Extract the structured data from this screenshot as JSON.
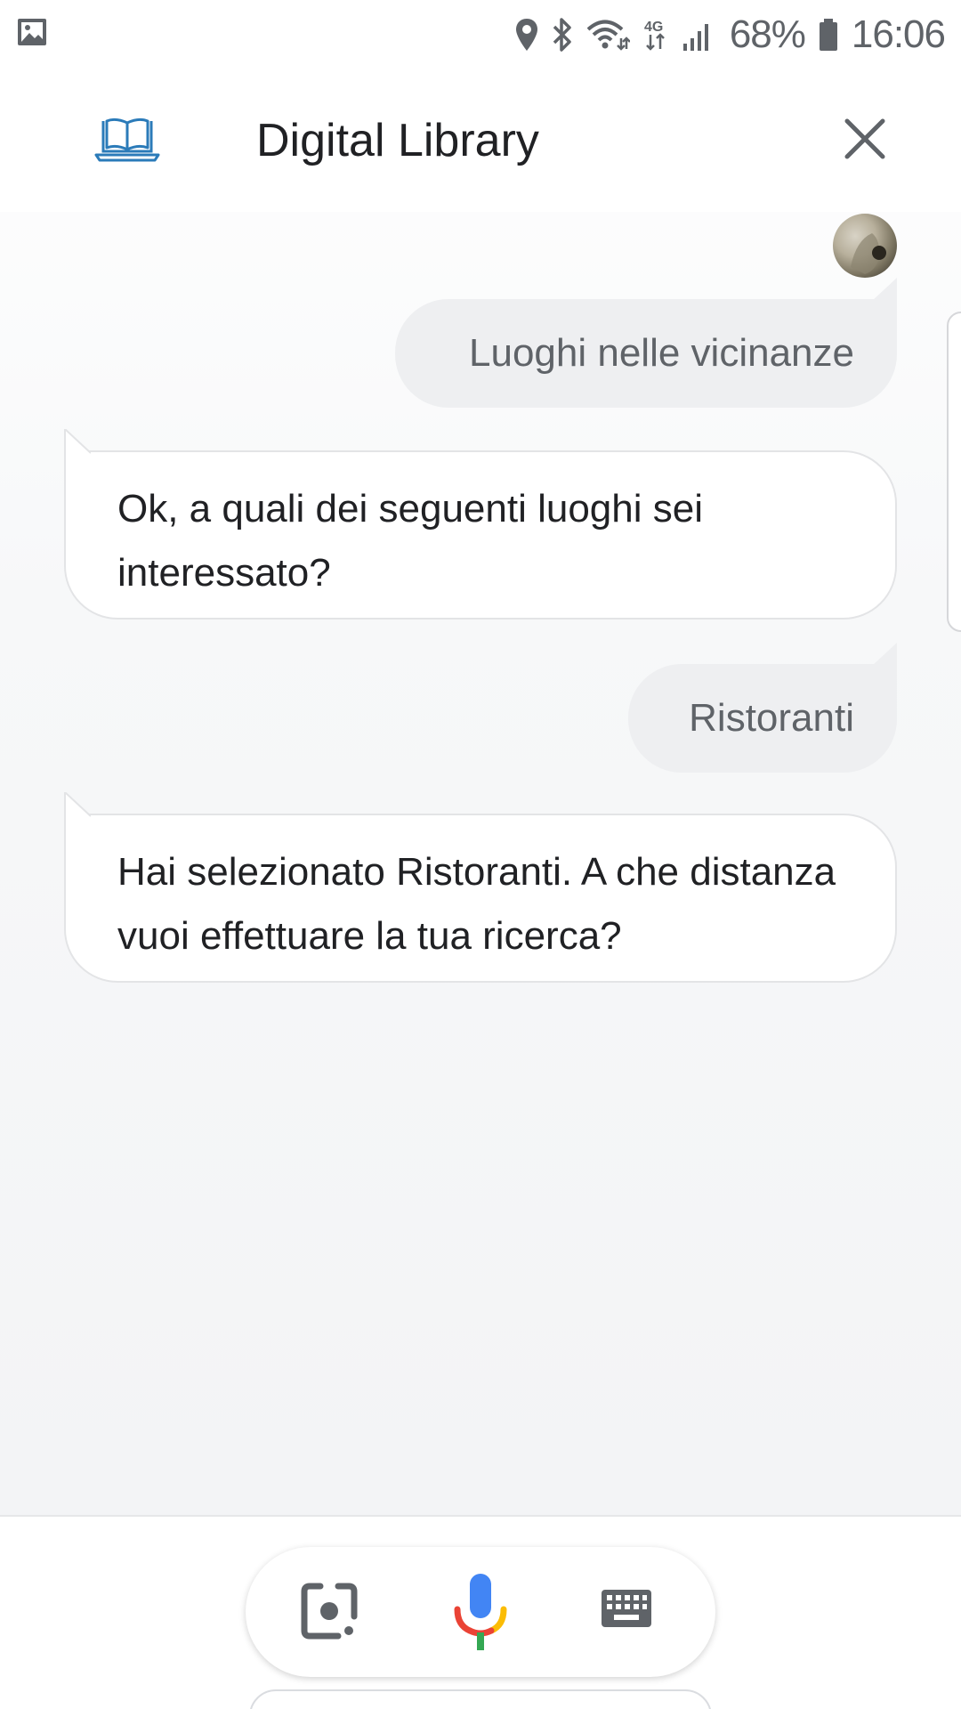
{
  "status_bar": {
    "battery_percent": "68%",
    "time": "16:06",
    "network_type": "4G",
    "icons": [
      "gallery-icon",
      "location-icon",
      "bluetooth-icon",
      "wifi-icon",
      "network-4g-icon",
      "signal-icon",
      "battery-icon"
    ]
  },
  "header": {
    "title": "Digital Library",
    "app_icon": "book-laptop-icon",
    "close_icon": "close-icon"
  },
  "conversation": [
    {
      "role": "user",
      "text": "Luoghi nelle vicinanze"
    },
    {
      "role": "assistant",
      "text": "Ok, a quali dei seguenti luoghi sei interessato?"
    },
    {
      "role": "user",
      "text": "Ristoranti"
    },
    {
      "role": "assistant",
      "text": "Hai selezionato Ristoranti. A che distanza vuoi effettuare la tua ricerca?"
    }
  ],
  "input_bar": {
    "buttons": [
      "lens-icon",
      "microphone-icon",
      "keyboard-icon"
    ]
  },
  "colors": {
    "accent_blue": "#1a73e8",
    "book_icon": "#2b7bb9",
    "mic_blue": "#4285f4",
    "mic_red": "#ea4335",
    "mic_yellow": "#fbbc04",
    "mic_green": "#34a853",
    "user_bubble": "#eeeff1"
  }
}
